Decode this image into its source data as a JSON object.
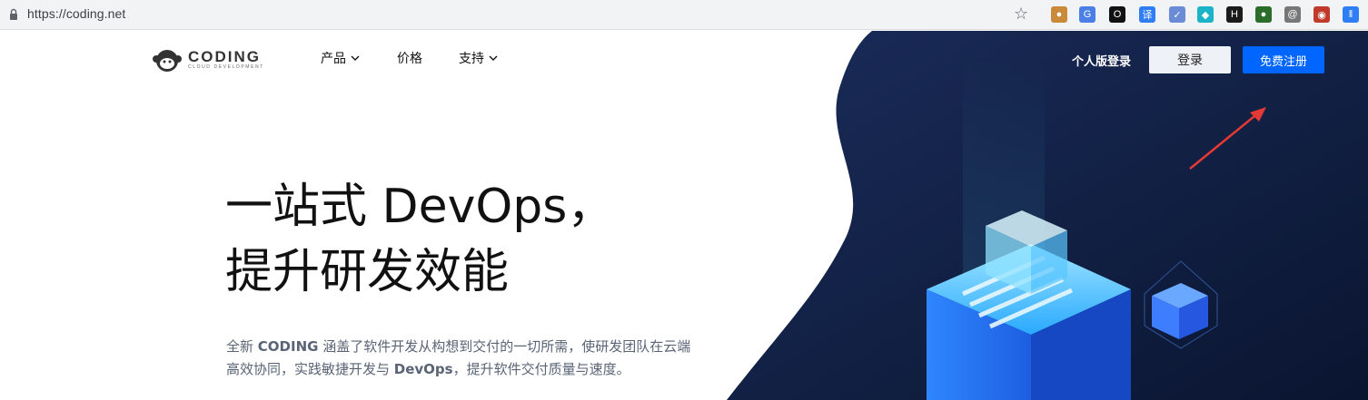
{
  "browser": {
    "url": "https://coding.net",
    "extensions": [
      {
        "name": "cookie-extension-icon",
        "glyph": "●",
        "color": "#c98b3a"
      },
      {
        "name": "translate-extension-icon",
        "glyph": "G",
        "color": "#4a7fe5"
      },
      {
        "name": "circle-extension-icon",
        "glyph": "O",
        "color": "#111111"
      },
      {
        "name": "translator-extension-icon",
        "glyph": "译",
        "color": "#2f7ef5"
      },
      {
        "name": "check-extension-icon",
        "glyph": "✓",
        "color": "#6a8cd6"
      },
      {
        "name": "cube-extension-icon",
        "glyph": "◆",
        "color": "#1ab3c8"
      },
      {
        "name": "h-extension-icon",
        "glyph": "H",
        "color": "#1a1a1a"
      },
      {
        "name": "green-ball-extension-icon",
        "glyph": "●",
        "color": "#2b6d2b"
      },
      {
        "name": "swirl-extension-icon",
        "glyph": "@",
        "color": "#777777"
      },
      {
        "name": "mask-extension-icon",
        "glyph": "◉",
        "color": "#c0392b"
      },
      {
        "name": "bars-extension-icon",
        "glyph": "‖",
        "color": "#2f7ef5"
      }
    ]
  },
  "header": {
    "logo": {
      "title": "CODING",
      "subtitle": "CLOUD DEVELOPMENT"
    },
    "nav": [
      {
        "label": "产品",
        "has_dropdown": true
      },
      {
        "label": "价格",
        "has_dropdown": false
      },
      {
        "label": "支持",
        "has_dropdown": true
      }
    ],
    "personal_login": "个人版登录",
    "login": "登录",
    "register": "免费注册"
  },
  "hero": {
    "line1": "一站式 DevOps，",
    "line2": "提升研发效能",
    "desc_prefix": "全新 ",
    "desc_brand": "CODING",
    "desc_mid": " 涵盖了软件开发从构想到交付的一切所需，使研发团队在云端高效协同，实践敏捷开发与 ",
    "desc_brand2": "DevOps",
    "desc_suffix": "，提升软件交付质量与速度。"
  },
  "colors": {
    "accent": "#0066ff",
    "dark_bg": "#0e1d3f",
    "annotation_arrow": "#e53935"
  }
}
